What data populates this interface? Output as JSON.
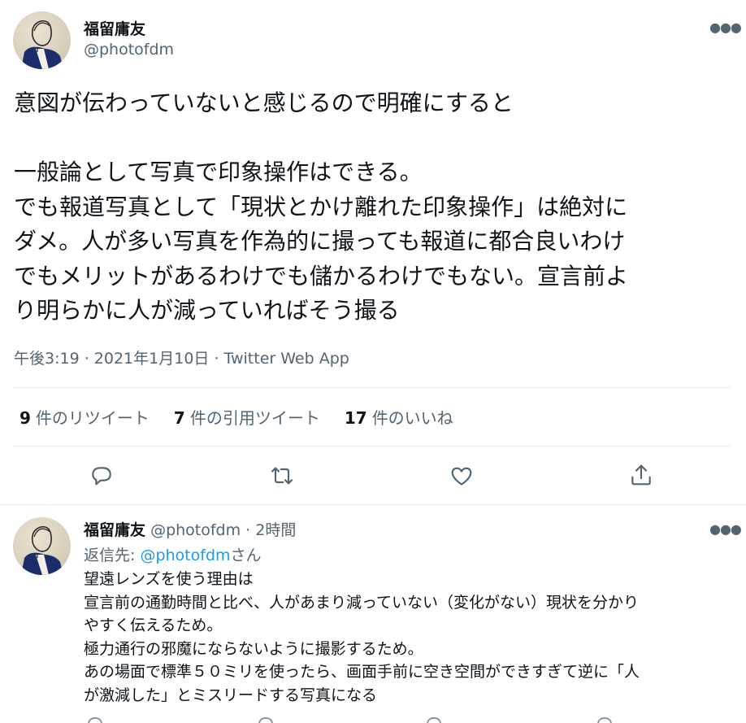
{
  "tweet": {
    "author": {
      "name": "福留庸友",
      "handle": "@photofdm"
    },
    "more_icon": "more-horizontal-icon",
    "body_lines": [
      "意図が伝わっていないと感じるので明確にすると",
      "",
      "一般論として写真で印象操作はできる。",
      "でも報道写真として「現状とかけ離れた印象操作」は絶対に",
      "ダメ。人が多い写真を作為的に撮っても報道に都合良いわけ",
      "でもメリットがあるわけでも儲かるわけでもない。宣言前よ",
      "り明らかに人が減っていればそう撮る"
    ],
    "meta": "午後3:19 · 2021年1月10日 · Twitter Web App",
    "stats": {
      "retweets": {
        "count": "9",
        "label": "件のリツイート"
      },
      "quotes": {
        "count": "7",
        "label": "件の引用ツイート"
      },
      "likes": {
        "count": "17",
        "label": "件のいいね"
      }
    },
    "actions": [
      {
        "name": "reply-button",
        "icon": "reply-icon"
      },
      {
        "name": "retweet-button",
        "icon": "retweet-icon"
      },
      {
        "name": "like-button",
        "icon": "heart-icon"
      },
      {
        "name": "share-button",
        "icon": "share-icon"
      }
    ]
  },
  "reply": {
    "author": {
      "name": "福留庸友",
      "handle": "@photofdm"
    },
    "dot": "·",
    "time": "2時間",
    "replying_prefix": "返信先: ",
    "replying_handle": "@photofdm",
    "replying_suffix": "さん",
    "body_lines": [
      "望遠レンズを使う理由は",
      "宣言前の通勤時間と比べ、人があまり減っていない（変化がない）現状を分かり",
      "やすく伝えるため。",
      "極力通行の邪魔にならないように撮影するため。",
      "あの場面で標準５０ミリを使ったら、画面手前に空き空間ができすぎて逆に「人",
      "が激減した」とミスリードする写真になる"
    ]
  },
  "colors": {
    "text": "#0f1419",
    "secondary": "#536471",
    "link": "#1d9bf0",
    "divider": "#e6ecf0",
    "background": "#ffffff"
  }
}
